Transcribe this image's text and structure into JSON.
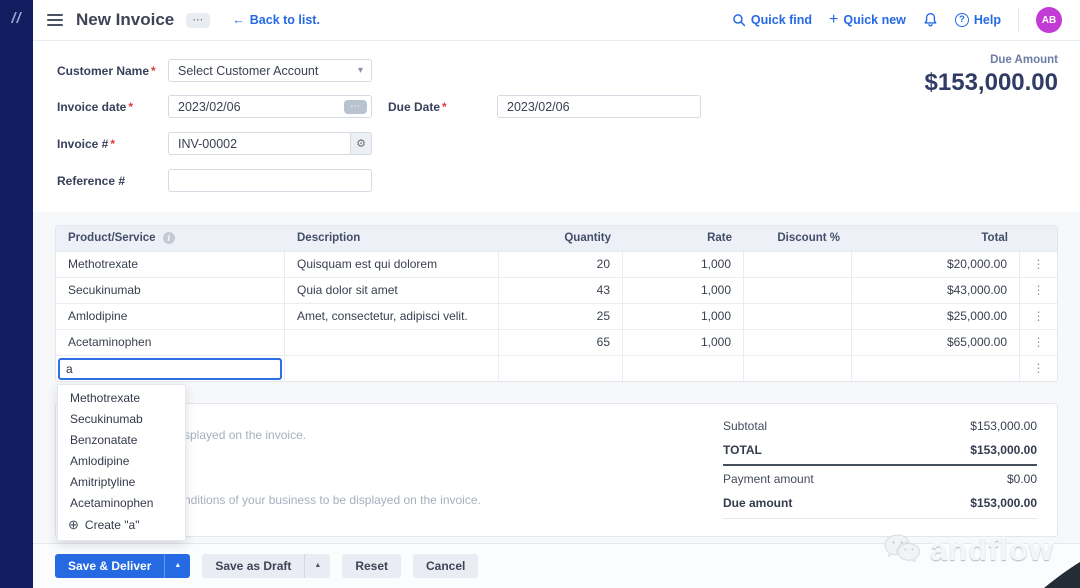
{
  "header": {
    "title": "New Invoice",
    "back_link": "Back to list.",
    "quick_find": "Quick find",
    "quick_new": "Quick new",
    "help": "Help",
    "avatar_initials": "AB"
  },
  "icons": {
    "more": "⋯",
    "back_arrow": "←",
    "plus": "+",
    "help_mark": "?",
    "select_caret": "▾",
    "date_badge": "⋯",
    "gear": "⚙",
    "info": "i",
    "kebab": "⋮",
    "caret_up": "▲",
    "create_plus": "⊕",
    "logo": "//"
  },
  "form": {
    "customer_name": {
      "label": "Customer Name",
      "required": "*",
      "value": "Select Customer Account"
    },
    "invoice_date": {
      "label": "Invoice date",
      "required": "*",
      "value": "2023/02/06"
    },
    "due_date": {
      "label": "Due Date",
      "required": "*",
      "value": "2023/02/06"
    },
    "invoice_number": {
      "label": "Invoice #",
      "required": "*",
      "value": "INV-00002"
    },
    "reference_number": {
      "label": "Reference #",
      "value": ""
    },
    "due_amount_label": "Due Amount",
    "due_amount_value": "$153,000.00"
  },
  "table": {
    "columns": [
      "Product/Service",
      "Description",
      "Quantity",
      "Rate",
      "Discount %",
      "Total"
    ],
    "rows": [
      {
        "product": "Methotrexate",
        "description": "Quisquam est qui dolorem",
        "quantity": "20",
        "rate": "1,000",
        "discount": "",
        "total": "$20,000.00"
      },
      {
        "product": "Secukinumab",
        "description": "Quia dolor sit amet",
        "quantity": "43",
        "rate": "1,000",
        "discount": "",
        "total": "$43,000.00"
      },
      {
        "product": "Amlodipine",
        "description": "Amet, consectetur, adipisci velit.",
        "quantity": "25",
        "rate": "1,000",
        "discount": "",
        "total": "$25,000.00"
      },
      {
        "product": "Acetaminophen",
        "description": "",
        "quantity": "65",
        "rate": "1,000",
        "discount": "",
        "total": "$65,000.00"
      }
    ],
    "new_row_input_value": "a"
  },
  "dropdown": {
    "items": [
      "Methotrexate",
      "Secukinumab",
      "Benzonatate",
      "Amlodipine",
      "Amitriptyline",
      "Acetaminophen"
    ],
    "create_label": "Create \"a\""
  },
  "notes": {
    "notes_placeholder_visible": "splayed on the invoice.",
    "terms_placeholder_visible": "nditions of your business to be displayed on the invoice."
  },
  "totals": {
    "rows": [
      {
        "label": "Subtotal",
        "value": "$153,000.00"
      },
      {
        "label": "TOTAL",
        "value": "$153,000.00"
      },
      {
        "label": "Payment amount",
        "value": "$0.00"
      },
      {
        "label": "Due amount",
        "value": "$153,000.00"
      }
    ]
  },
  "footer": {
    "save_deliver": "Save & Deliver",
    "save_draft": "Save as Draft",
    "reset": "Reset",
    "cancel": "Cancel"
  },
  "watermark": "andflow",
  "colors": {
    "brand_navy": "#101d5e",
    "accent_blue": "#2569e3",
    "avatar_purple": "#c23bd4",
    "amount_navy": "#313c66",
    "table_header_bg": "#edf0f7",
    "section_bg": "#f7f8fa"
  }
}
